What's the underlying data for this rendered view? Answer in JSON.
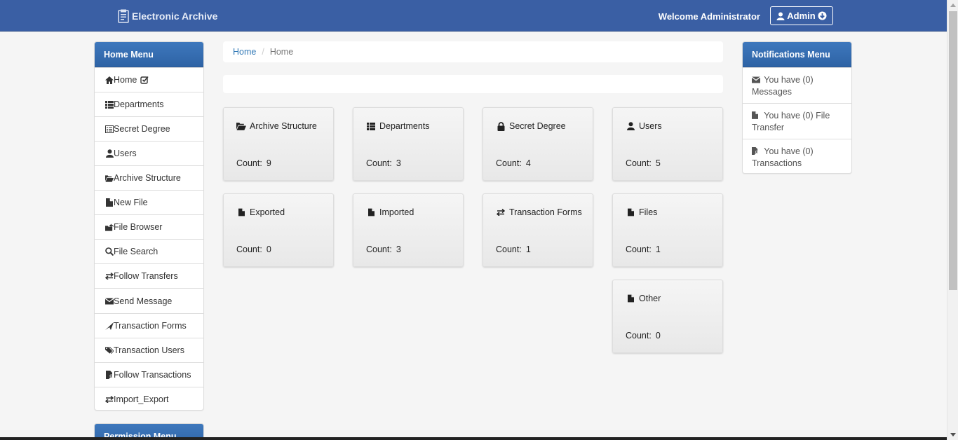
{
  "navbar": {
    "brand": "Electronic Archive",
    "welcome": "Welcome Administrator",
    "admin_label": "Admin"
  },
  "home_menu": {
    "title": "Home Menu",
    "items": [
      {
        "label": "Home",
        "icon": "home-icon"
      },
      {
        "label": "Departments",
        "icon": "list-icon"
      },
      {
        "label": "Secret Degree",
        "icon": "list-alt-icon"
      },
      {
        "label": "Users",
        "icon": "user-icon"
      },
      {
        "label": "Archive Structure",
        "icon": "folder-open-icon"
      },
      {
        "label": "New File",
        "icon": "file-icon"
      },
      {
        "label": "File Browser",
        "icon": "folder-share-icon"
      },
      {
        "label": "File Search",
        "icon": "search-icon"
      },
      {
        "label": "Follow Transfers",
        "icon": "transfer-icon"
      },
      {
        "label": "Send Message",
        "icon": "envelope-icon"
      },
      {
        "label": "Transaction Forms",
        "icon": "send-icon"
      },
      {
        "label": "Transaction Users",
        "icon": "tags-icon"
      },
      {
        "label": "Follow Transactions",
        "icon": "file-user-icon"
      },
      {
        "label": "Import_Export",
        "icon": "transfer-icon"
      }
    ]
  },
  "permission_menu": {
    "title": "Permission Menu"
  },
  "breadcrumb": {
    "home": "Home",
    "current": "Home"
  },
  "tiles": [
    {
      "title": "Archive Structure",
      "count_label": "Count:",
      "count": "9",
      "icon": "folder-open-icon"
    },
    {
      "title": "Departments",
      "count_label": "Count:",
      "count": "3",
      "icon": "list-icon"
    },
    {
      "title": "Secret Degree",
      "count_label": "Count:",
      "count": "4",
      "icon": "lock-icon"
    },
    {
      "title": "Users",
      "count_label": "Count:",
      "count": "5",
      "icon": "user-icon"
    },
    {
      "title": "Exported",
      "count_label": "Count:",
      "count": "0",
      "icon": "file-icon"
    },
    {
      "title": "Imported",
      "count_label": "Count:",
      "count": "3",
      "icon": "file-icon"
    },
    {
      "title": "Transaction Forms",
      "count_label": "Count:",
      "count": "1",
      "icon": "transfer-icon"
    },
    {
      "title": "Files",
      "count_label": "Count:",
      "count": "1",
      "icon": "file-icon"
    },
    {
      "title": "Other",
      "count_label": "Count:",
      "count": "0",
      "icon": "file-icon"
    }
  ],
  "notifications": {
    "title": "Notifications Menu",
    "items": [
      {
        "text": "You have (0) Messages",
        "icon": "envelope-icon"
      },
      {
        "text": "You have (0) File Transfer",
        "icon": "file-icon"
      },
      {
        "text": "You have (0) Transactions",
        "icon": "file-user-icon"
      }
    ]
  },
  "colors": {
    "navbar": "#3a5fa4",
    "panel_heading": "#2e63a5",
    "link": "#337ab7"
  }
}
